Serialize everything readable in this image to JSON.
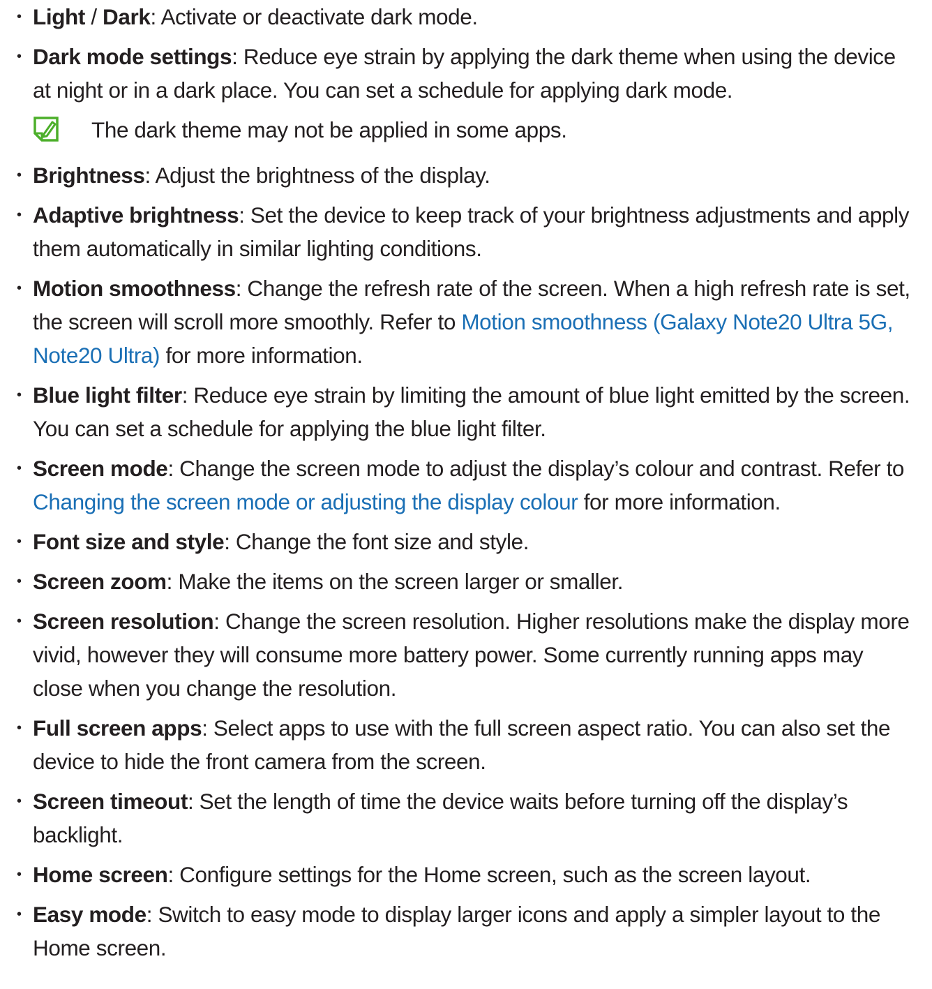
{
  "items": [
    {
      "term": "Light",
      "sep": " / ",
      "term2": "Dark",
      "text": ": Activate or deactivate dark mode."
    },
    {
      "term": "Dark mode settings",
      "text": ": Reduce eye strain by applying the dark theme when using the device at night or in a dark place. You can set a schedule for applying dark mode."
    },
    {
      "term": "Brightness",
      "text": ": Adjust the brightness of the display."
    },
    {
      "term": "Adaptive brightness",
      "text": ": Set the device to keep track of your brightness adjustments and apply them automatically in similar lighting conditions."
    },
    {
      "term": "Motion smoothness",
      "text": ": Change the refresh rate of the screen. When a high refresh rate is set, the screen will scroll more smoothly. Refer to ",
      "link": "Motion smoothness (Galaxy Note20 Ultra 5G, Note20 Ultra)",
      "after": " for more information."
    },
    {
      "term": "Blue light filter",
      "text": ": Reduce eye strain by limiting the amount of blue light emitted by the screen. You can set a schedule for applying the blue light filter."
    },
    {
      "term": "Screen mode",
      "text": ": Change the screen mode to adjust the display’s colour and contrast. Refer to ",
      "link": "Changing the screen mode or adjusting the display colour",
      "after": " for more information."
    },
    {
      "term": "Font size and style",
      "text": ": Change the font size and style."
    },
    {
      "term": "Screen zoom",
      "text": ": Make the items on the screen larger or smaller."
    },
    {
      "term": "Screen resolution",
      "text": ": Change the screen resolution. Higher resolutions make the display more vivid, however they will consume more battery power. Some currently running apps may close when you change the resolution."
    },
    {
      "term": "Full screen apps",
      "text": ": Select apps to use with the full screen aspect ratio. You can also set the device to hide the front camera from the screen."
    },
    {
      "term": "Screen timeout",
      "text": ": Set the length of time the device waits before turning off the display’s backlight."
    },
    {
      "term": "Home screen",
      "text": ": Configure settings for the Home screen, such as the screen layout."
    },
    {
      "term": "Easy mode",
      "text": ": Switch to easy mode to display larger icons and apply a simpler layout to the Home screen."
    }
  ],
  "note": {
    "icon": "note-pencil-icon",
    "text": "The dark theme may not be applied in some apps."
  },
  "colors": {
    "text": "#231f20",
    "link": "#1a6fb5",
    "note_icon": "#4caf2a"
  },
  "bullet": "•"
}
